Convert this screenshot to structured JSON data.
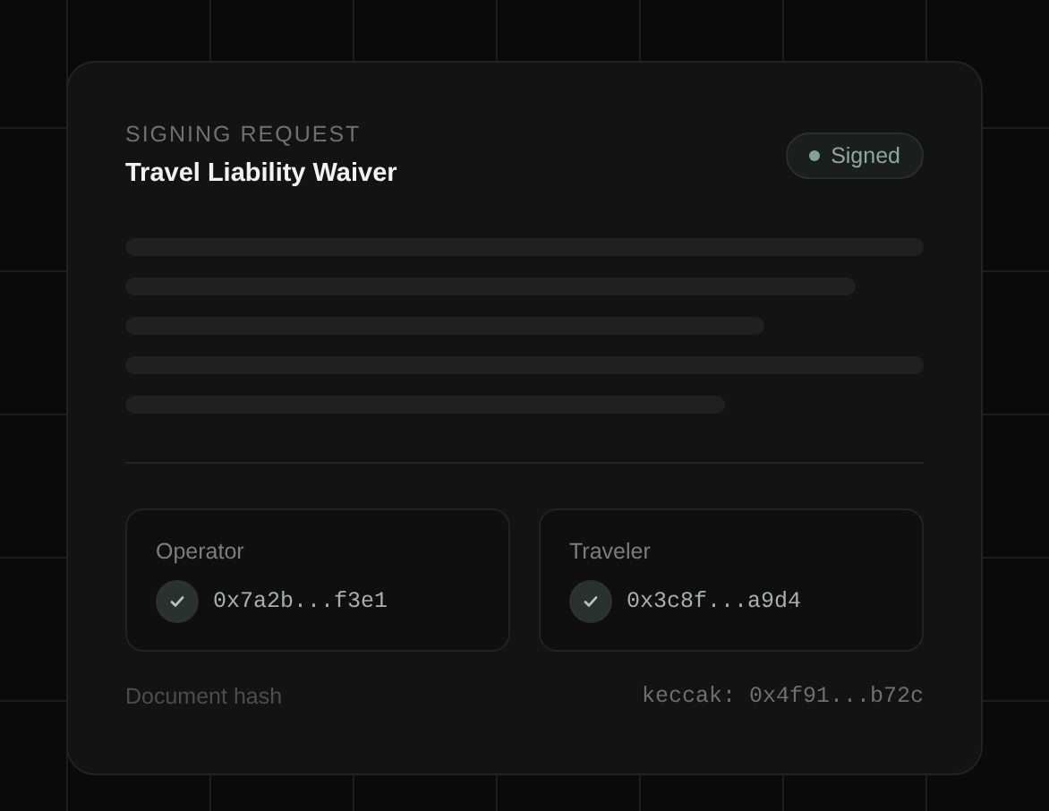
{
  "header": {
    "eyebrow": "SIGNING REQUEST",
    "title": "Travel Liability Waiver"
  },
  "status": {
    "label": "Signed",
    "color": "#7fa592"
  },
  "document_preview": {
    "kind": "skeleton"
  },
  "signers": [
    {
      "role": "Operator",
      "address": "0x7a2b...f3e1",
      "verified": true
    },
    {
      "role": "Traveler",
      "address": "0x3c8f...a9d4",
      "verified": true
    }
  ],
  "footer": {
    "label": "Document hash",
    "value": "keccak: 0x4f91...b72c"
  }
}
